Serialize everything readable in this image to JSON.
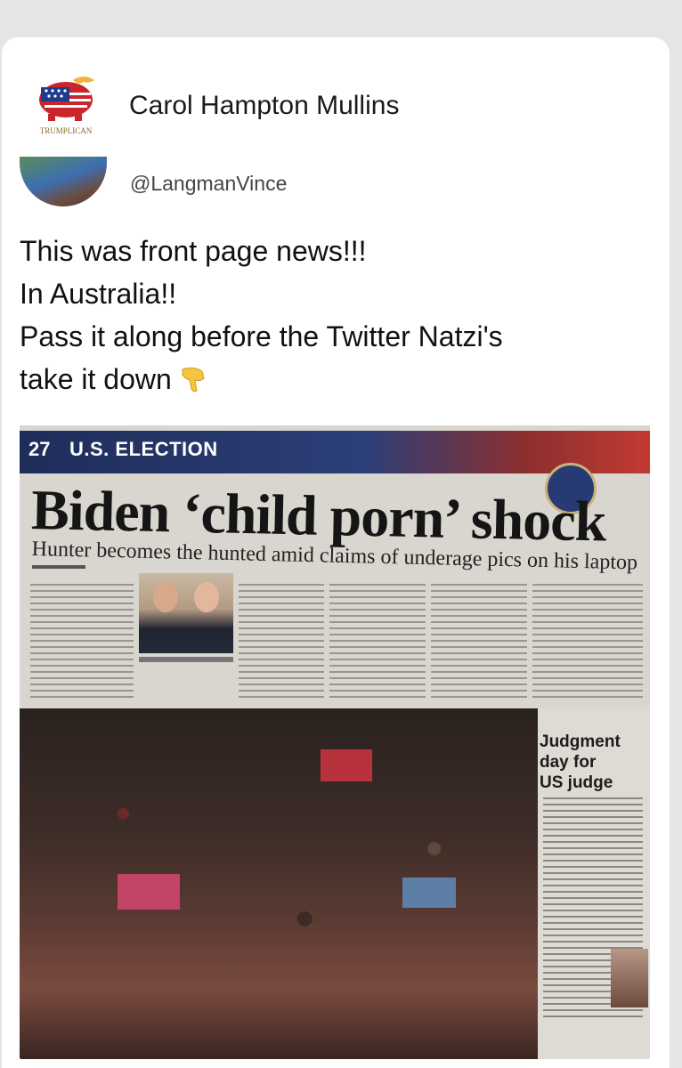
{
  "post": {
    "author_name": "Carol Hampton Mullins",
    "author_logo_icon": "trumplican-elephant-logo-icon",
    "author_logo_text": "TRUMPLICAN",
    "retweet_handle": "@LangmanVince",
    "tweet_lines": [
      "This was front page news!!!",
      "In Australia!!",
      "Pass it along before the Twitter Natzi's",
      "take it down"
    ],
    "emoji_icon": "pointing-down-hand-icon"
  },
  "newspaper": {
    "page_number": "27",
    "section": "U.S. ELECTION",
    "headline": "Biden ‘child porn’ shock",
    "subheadline": "Hunter becomes the hunted amid claims of underage pics on his laptop",
    "sidebar_headline_lines": [
      "Judgment",
      "day for",
      "US judge"
    ]
  }
}
